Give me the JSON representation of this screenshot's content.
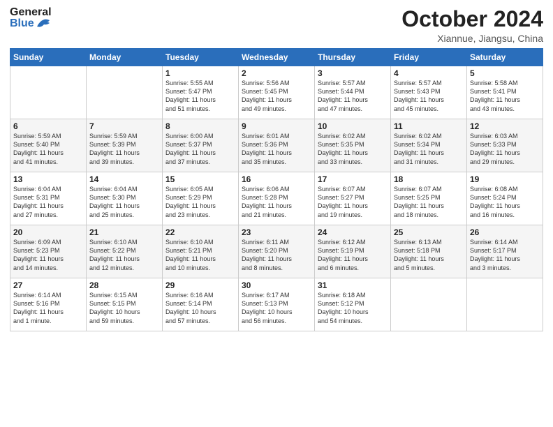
{
  "logo": {
    "general": "General",
    "blue": "Blue"
  },
  "title": "October 2024",
  "location": "Xiannue, Jiangsu, China",
  "header_days": [
    "Sunday",
    "Monday",
    "Tuesday",
    "Wednesday",
    "Thursday",
    "Friday",
    "Saturday"
  ],
  "weeks": [
    [
      {
        "day": "",
        "info": ""
      },
      {
        "day": "",
        "info": ""
      },
      {
        "day": "1",
        "info": "Sunrise: 5:55 AM\nSunset: 5:47 PM\nDaylight: 11 hours\nand 51 minutes."
      },
      {
        "day": "2",
        "info": "Sunrise: 5:56 AM\nSunset: 5:45 PM\nDaylight: 11 hours\nand 49 minutes."
      },
      {
        "day": "3",
        "info": "Sunrise: 5:57 AM\nSunset: 5:44 PM\nDaylight: 11 hours\nand 47 minutes."
      },
      {
        "day": "4",
        "info": "Sunrise: 5:57 AM\nSunset: 5:43 PM\nDaylight: 11 hours\nand 45 minutes."
      },
      {
        "day": "5",
        "info": "Sunrise: 5:58 AM\nSunset: 5:41 PM\nDaylight: 11 hours\nand 43 minutes."
      }
    ],
    [
      {
        "day": "6",
        "info": "Sunrise: 5:59 AM\nSunset: 5:40 PM\nDaylight: 11 hours\nand 41 minutes."
      },
      {
        "day": "7",
        "info": "Sunrise: 5:59 AM\nSunset: 5:39 PM\nDaylight: 11 hours\nand 39 minutes."
      },
      {
        "day": "8",
        "info": "Sunrise: 6:00 AM\nSunset: 5:37 PM\nDaylight: 11 hours\nand 37 minutes."
      },
      {
        "day": "9",
        "info": "Sunrise: 6:01 AM\nSunset: 5:36 PM\nDaylight: 11 hours\nand 35 minutes."
      },
      {
        "day": "10",
        "info": "Sunrise: 6:02 AM\nSunset: 5:35 PM\nDaylight: 11 hours\nand 33 minutes."
      },
      {
        "day": "11",
        "info": "Sunrise: 6:02 AM\nSunset: 5:34 PM\nDaylight: 11 hours\nand 31 minutes."
      },
      {
        "day": "12",
        "info": "Sunrise: 6:03 AM\nSunset: 5:33 PM\nDaylight: 11 hours\nand 29 minutes."
      }
    ],
    [
      {
        "day": "13",
        "info": "Sunrise: 6:04 AM\nSunset: 5:31 PM\nDaylight: 11 hours\nand 27 minutes."
      },
      {
        "day": "14",
        "info": "Sunrise: 6:04 AM\nSunset: 5:30 PM\nDaylight: 11 hours\nand 25 minutes."
      },
      {
        "day": "15",
        "info": "Sunrise: 6:05 AM\nSunset: 5:29 PM\nDaylight: 11 hours\nand 23 minutes."
      },
      {
        "day": "16",
        "info": "Sunrise: 6:06 AM\nSunset: 5:28 PM\nDaylight: 11 hours\nand 21 minutes."
      },
      {
        "day": "17",
        "info": "Sunrise: 6:07 AM\nSunset: 5:27 PM\nDaylight: 11 hours\nand 19 minutes."
      },
      {
        "day": "18",
        "info": "Sunrise: 6:07 AM\nSunset: 5:25 PM\nDaylight: 11 hours\nand 18 minutes."
      },
      {
        "day": "19",
        "info": "Sunrise: 6:08 AM\nSunset: 5:24 PM\nDaylight: 11 hours\nand 16 minutes."
      }
    ],
    [
      {
        "day": "20",
        "info": "Sunrise: 6:09 AM\nSunset: 5:23 PM\nDaylight: 11 hours\nand 14 minutes."
      },
      {
        "day": "21",
        "info": "Sunrise: 6:10 AM\nSunset: 5:22 PM\nDaylight: 11 hours\nand 12 minutes."
      },
      {
        "day": "22",
        "info": "Sunrise: 6:10 AM\nSunset: 5:21 PM\nDaylight: 11 hours\nand 10 minutes."
      },
      {
        "day": "23",
        "info": "Sunrise: 6:11 AM\nSunset: 5:20 PM\nDaylight: 11 hours\nand 8 minutes."
      },
      {
        "day": "24",
        "info": "Sunrise: 6:12 AM\nSunset: 5:19 PM\nDaylight: 11 hours\nand 6 minutes."
      },
      {
        "day": "25",
        "info": "Sunrise: 6:13 AM\nSunset: 5:18 PM\nDaylight: 11 hours\nand 5 minutes."
      },
      {
        "day": "26",
        "info": "Sunrise: 6:14 AM\nSunset: 5:17 PM\nDaylight: 11 hours\nand 3 minutes."
      }
    ],
    [
      {
        "day": "27",
        "info": "Sunrise: 6:14 AM\nSunset: 5:16 PM\nDaylight: 11 hours\nand 1 minute."
      },
      {
        "day": "28",
        "info": "Sunrise: 6:15 AM\nSunset: 5:15 PM\nDaylight: 10 hours\nand 59 minutes."
      },
      {
        "day": "29",
        "info": "Sunrise: 6:16 AM\nSunset: 5:14 PM\nDaylight: 10 hours\nand 57 minutes."
      },
      {
        "day": "30",
        "info": "Sunrise: 6:17 AM\nSunset: 5:13 PM\nDaylight: 10 hours\nand 56 minutes."
      },
      {
        "day": "31",
        "info": "Sunrise: 6:18 AM\nSunset: 5:12 PM\nDaylight: 10 hours\nand 54 minutes."
      },
      {
        "day": "",
        "info": ""
      },
      {
        "day": "",
        "info": ""
      }
    ]
  ]
}
